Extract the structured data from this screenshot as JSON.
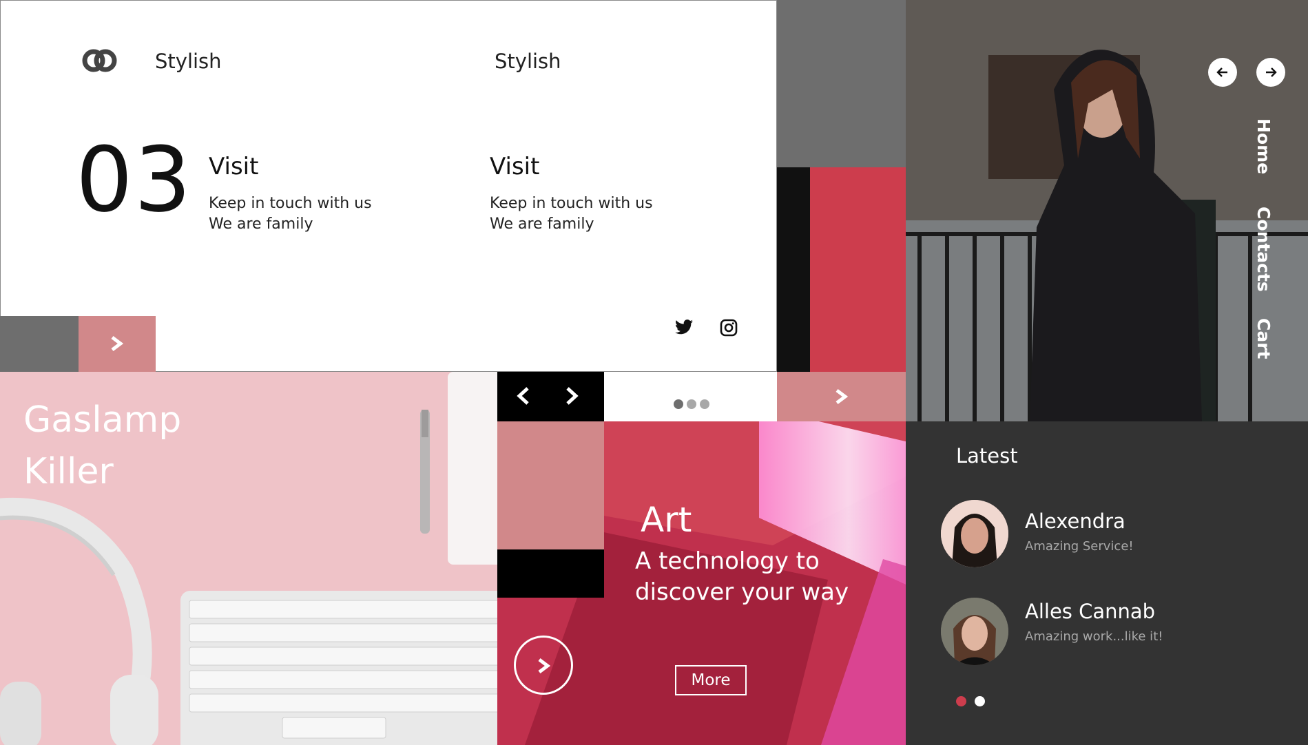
{
  "brand": {
    "name": "Stylish",
    "logo_icon": "rings-logo-icon"
  },
  "header": {
    "second_title": "Stylish"
  },
  "counter": {
    "value": "03"
  },
  "visit_left": {
    "heading": "Visit",
    "line1": "Keep in touch with us",
    "line2": "We are family"
  },
  "visit_right": {
    "heading": "Visit",
    "line1": "Keep in touch with us",
    "line2": "We are family"
  },
  "social": {
    "icons": [
      "twitter-icon",
      "instagram-icon"
    ]
  },
  "slider": {
    "dots_total": 3,
    "active_dot": 1
  },
  "hero": {
    "title_line1": "Gaslamp",
    "title_line2": "Killer"
  },
  "side_nav": {
    "items": [
      "Home",
      "Contacts",
      "Cart"
    ]
  },
  "art": {
    "title": "Art",
    "subtitle_line1": "A technology to",
    "subtitle_line2": "discover your way",
    "button": "More"
  },
  "latest": {
    "title": "Latest",
    "items": [
      {
        "name": "Alexendra",
        "comment": "Amazing Service!"
      },
      {
        "name": "Alles Cannab",
        "comment": "Amazing work...like it!"
      }
    ],
    "dots_total": 2,
    "active_dot": 1
  },
  "colors": {
    "accent_pink": "#d1888a",
    "accent_red": "#cd3d4d",
    "dark": "#333333",
    "gray": "#6e6e6e",
    "pink_bg": "#efc3c8"
  }
}
